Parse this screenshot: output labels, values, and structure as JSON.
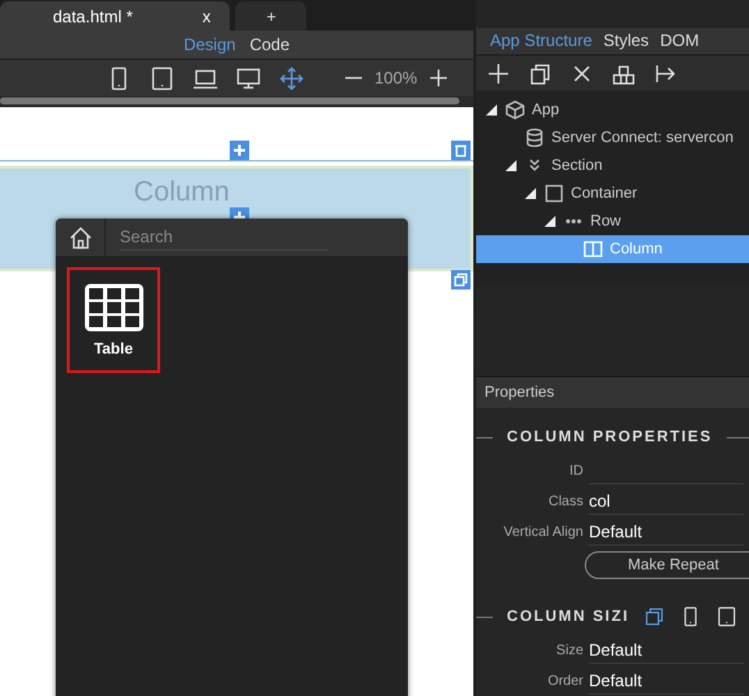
{
  "editor_tabs": [
    {
      "label": "data.html *",
      "close": "x",
      "selected": true
    },
    {
      "label": "+",
      "selected": false
    }
  ],
  "view_modes": [
    {
      "label": "Design",
      "selected": true
    },
    {
      "label": "Code",
      "selected": false
    }
  ],
  "device_modes": [
    {
      "kind": "phone",
      "selected": false
    },
    {
      "kind": "tablet",
      "selected": false
    },
    {
      "kind": "laptop",
      "selected": false
    },
    {
      "kind": "desktop",
      "selected": false
    },
    {
      "kind": "move",
      "selected": true
    }
  ],
  "zoom": "100%",
  "canvas": {
    "column_label": "Column"
  },
  "popup": {
    "search": {
      "placeholder": "Search"
    },
    "items": [
      {
        "label": "Table",
        "selected": true
      }
    ]
  },
  "structure": {
    "tabs": [
      {
        "label": "App Structure",
        "selected": true
      },
      {
        "label": "Styles",
        "selected": false
      },
      {
        "label": "DOM",
        "selected": false
      }
    ],
    "tree": [
      {
        "label": "App",
        "kind": "app",
        "expanded": true,
        "selected": false,
        "children": [
          {
            "label": "Server Connect: servercon",
            "kind": "database",
            "selected": false
          },
          {
            "label": "Section",
            "kind": "section",
            "expanded": true,
            "selected": false,
            "children": [
              {
                "label": "Container",
                "kind": "container",
                "expanded": true,
                "selected": false,
                "children": [
                  {
                    "label": "Row",
                    "kind": "row",
                    "expanded": true,
                    "selected": false,
                    "children": [
                      {
                        "label": "Column",
                        "kind": "column",
                        "selected": true
                      }
                    ]
                  }
                ]
              }
            ]
          }
        ]
      }
    ]
  },
  "properties": {
    "title": "Properties",
    "sections": [
      {
        "heading": "COLUMN PROPERTIES",
        "fields": [
          {
            "label": "ID"
          },
          {
            "label": "Class",
            "value": "col"
          },
          {
            "label": "Vertical Align",
            "value": "Default"
          }
        ],
        "button": "Make Repeat"
      },
      {
        "heading": "COLUMN SIZI",
        "breakpoints": [
          {
            "kind": "all",
            "selected": true
          },
          {
            "kind": "phone",
            "selected": false
          },
          {
            "kind": "tablet",
            "selected": false
          }
        ],
        "fields": [
          {
            "label": "Size",
            "value": "Default"
          },
          {
            "label": "Order",
            "value": "Default"
          }
        ]
      }
    ]
  }
}
